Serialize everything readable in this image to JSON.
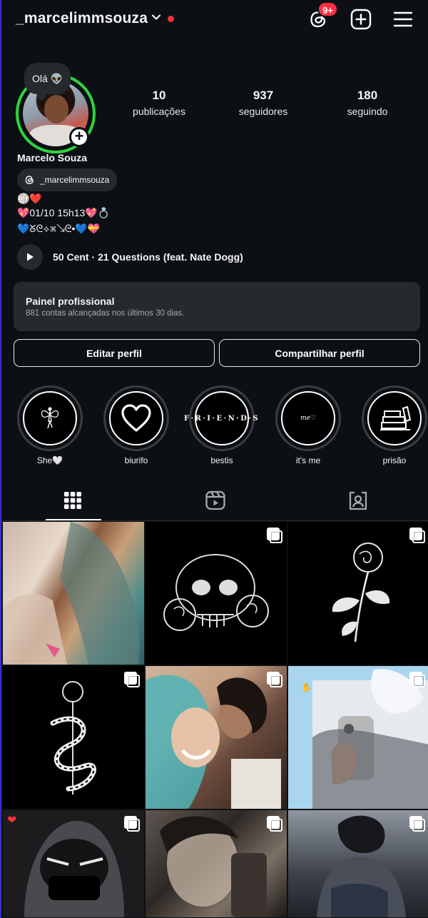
{
  "header": {
    "username": "_marcelimmsouza",
    "notification_badge": "9+"
  },
  "note": "Olá 👽",
  "stats": [
    {
      "value": "10",
      "label": "publicações"
    },
    {
      "value": "937",
      "label": "seguidores"
    },
    {
      "value": "180",
      "label": "seguindo"
    }
  ],
  "profile": {
    "full_name": "Marcelo Souza",
    "threads_handle": "_marcelimmsouza",
    "bio": [
      "🏐❤️",
      "💖01/10 15h13💖💍",
      "💙ᘜᘓ⟡⌘↘ᘓ•💙💝"
    ]
  },
  "music": {
    "text": "50 Cent · 21 Questions (feat. Nate Dogg)"
  },
  "dashboard": {
    "title": "Painel profissional",
    "subtitle": "881 contas alcançadas nos últimos 30 dias."
  },
  "buttons": {
    "edit": "Editar perfil",
    "share": "Compartilhar perfil"
  },
  "highlights": [
    {
      "label": "She🤍",
      "icon": "fairy-icon"
    },
    {
      "label": "biurifo",
      "icon": "heart-icon"
    },
    {
      "label": "bestis",
      "icon": "friends-logo",
      "text": "F·R·I·E·N·D·S"
    },
    {
      "label": "it's me",
      "icon": "me-text",
      "text": "me♡"
    },
    {
      "label": "prisão",
      "icon": "books-icon"
    }
  ],
  "tabs": [
    "grid-icon",
    "reels-icon",
    "tagged-icon"
  ],
  "posts": [
    {
      "desc": "photo",
      "multi": false
    },
    {
      "desc": "skull-roses",
      "multi": true
    },
    {
      "desc": "rose",
      "multi": true
    },
    {
      "desc": "snake-rose",
      "multi": true
    },
    {
      "desc": "selfie",
      "multi": true
    },
    {
      "desc": "anime-mirror",
      "multi": true
    },
    {
      "desc": "hooded",
      "multi": true
    },
    {
      "desc": "blurry",
      "multi": true
    },
    {
      "desc": "anime-sitting",
      "multi": true
    }
  ],
  "colors": {
    "background": "#0c1014",
    "story_ring": "#2ed43c",
    "badge": "#ff3040",
    "surface": "#262a2f"
  }
}
